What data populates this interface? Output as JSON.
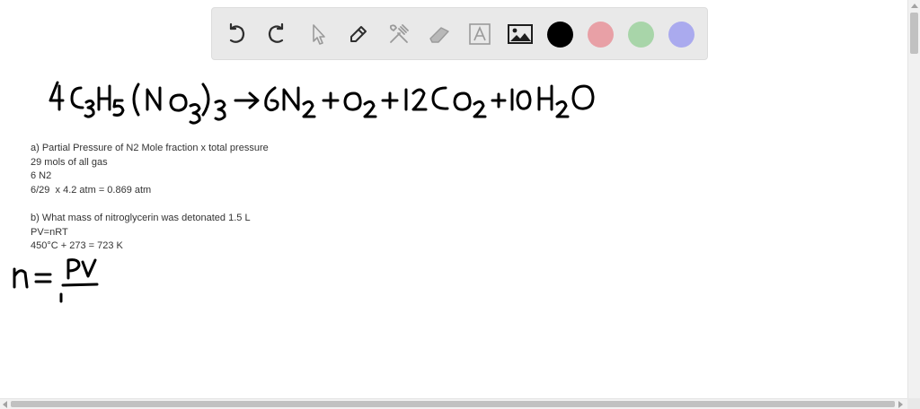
{
  "toolbar": {
    "tools": [
      {
        "name": "undo-icon",
        "enabled": true
      },
      {
        "name": "redo-icon",
        "enabled": true
      },
      {
        "name": "select-pointer-icon",
        "enabled": false
      },
      {
        "name": "pen-icon",
        "enabled": true
      },
      {
        "name": "tools-icon",
        "enabled": false
      },
      {
        "name": "eraser-icon",
        "enabled": false
      },
      {
        "name": "text-icon",
        "enabled": false
      },
      {
        "name": "image-icon",
        "enabled": true
      }
    ],
    "colors": [
      "#000000",
      "#e8a0a6",
      "#a8d5a9",
      "#aaaaee"
    ]
  },
  "handwriting": {
    "equation": "4C3H5(NO3)3 → 6N2 + O2 + 12CO2 + 10H2O",
    "formula": "n = PV / r"
  },
  "notes": {
    "part_a": [
      "a) Partial Pressure of N2 Mole fraction x total pressure",
      "29 mols of all gas",
      "6 N2",
      "6/29  x 4.2 atm = 0.869 atm"
    ],
    "part_b": [
      "b) What mass of nitroglycerin was detonated 1.5 L",
      "PV=nRT",
      "450°C + 273 = 723 K"
    ]
  }
}
